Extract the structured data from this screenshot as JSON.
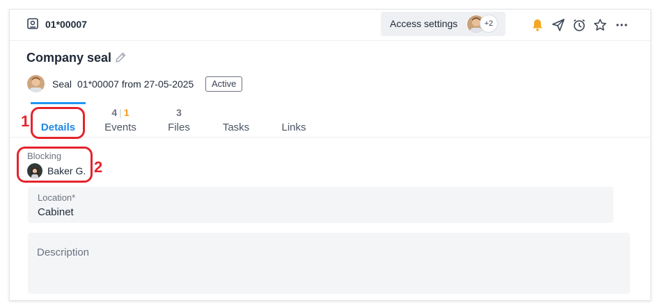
{
  "header": {
    "doc_id": "01*00007",
    "access_label": "Access settings",
    "access_extra": "+2",
    "icons": [
      "bell-icon",
      "send-icon",
      "alarm-icon",
      "star-icon",
      "more-icon"
    ]
  },
  "record": {
    "title": "Company seal",
    "type": "Seal",
    "number_date": "01*00007 from 27-05-2025",
    "status": "Active"
  },
  "tabs": [
    {
      "label": "Details",
      "active": true
    },
    {
      "label": "Events",
      "count_a": "4",
      "count_b": "1"
    },
    {
      "label": "Files",
      "count": "3"
    },
    {
      "label": "Tasks"
    },
    {
      "label": "Links"
    }
  ],
  "annotations": {
    "one": "1",
    "two": "2"
  },
  "fields": {
    "blocking_label": "Blocking",
    "blocking_user": "Baker G.",
    "location_label": "Location*",
    "location_value": "Cabinet",
    "description_placeholder": "Description"
  },
  "colors": {
    "accent": "#2196f3",
    "annotation": "#e5232b",
    "bell": "#f5a623",
    "events_count": "#f39c12"
  }
}
